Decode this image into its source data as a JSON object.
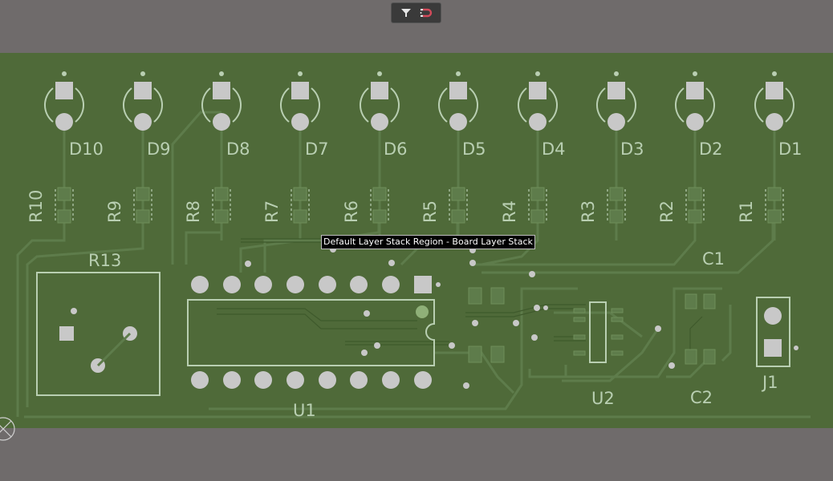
{
  "toolbar": {
    "buttons": [
      {
        "name": "filter",
        "icon": "filter-icon"
      },
      {
        "name": "snap",
        "icon": "magnet-icon"
      }
    ]
  },
  "tooltip": "Default Layer Stack Region - Board Layer Stack",
  "designators": {
    "leds": [
      "D10",
      "D9",
      "D8",
      "D7",
      "D6",
      "D5",
      "D4",
      "D3",
      "D2",
      "D1"
    ],
    "resistors": [
      "R10",
      "R9",
      "R8",
      "R7",
      "R6",
      "R5",
      "R4",
      "R3",
      "R2",
      "R1"
    ],
    "r13": "R13",
    "u1": "U1",
    "u2": "U2",
    "c1": "C1",
    "c2": "C2",
    "j1": "J1"
  },
  "colors": {
    "background": "#6f6b6b",
    "board": "#4f6a39",
    "silkscreen": "#b9cfb2",
    "pad": "#c8c8c8",
    "trace": "#5b7a49"
  }
}
